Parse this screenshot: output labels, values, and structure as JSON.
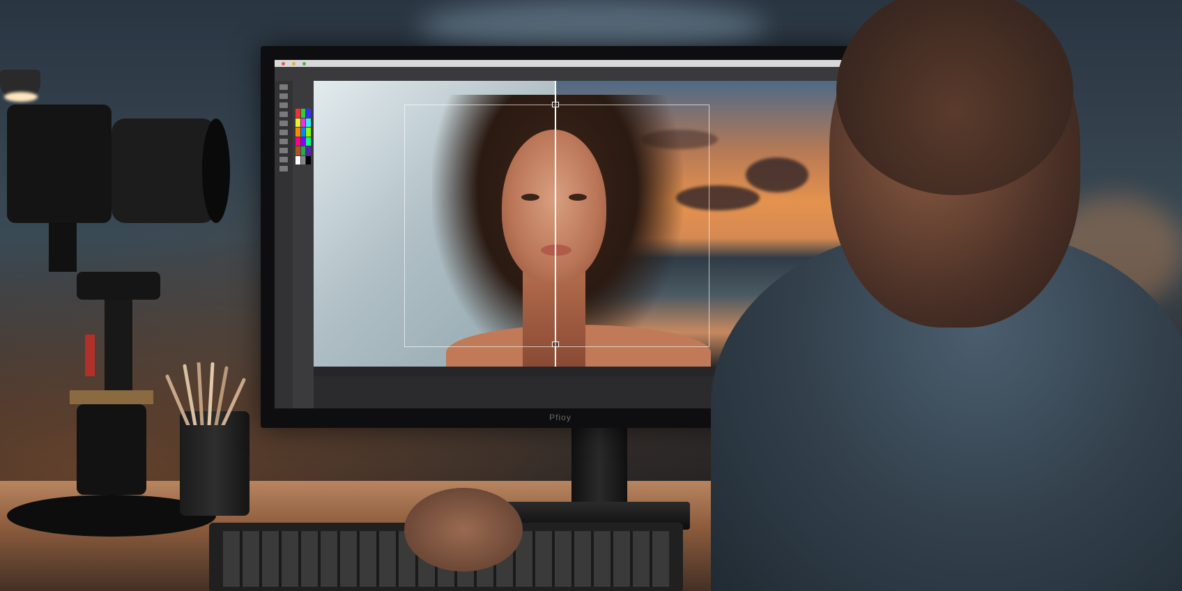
{
  "scene": {
    "description_tags": [
      "monitor",
      "photo-editor",
      "portrait",
      "camera",
      "desk",
      "keyboard",
      "person"
    ]
  },
  "monitor": {
    "brand": "Pfioy",
    "app": {
      "window_title": "",
      "menu_items": [],
      "status_text": ""
    }
  },
  "colors": {
    "accent_sky": "#e4924e",
    "split_line": "#ffffff"
  }
}
